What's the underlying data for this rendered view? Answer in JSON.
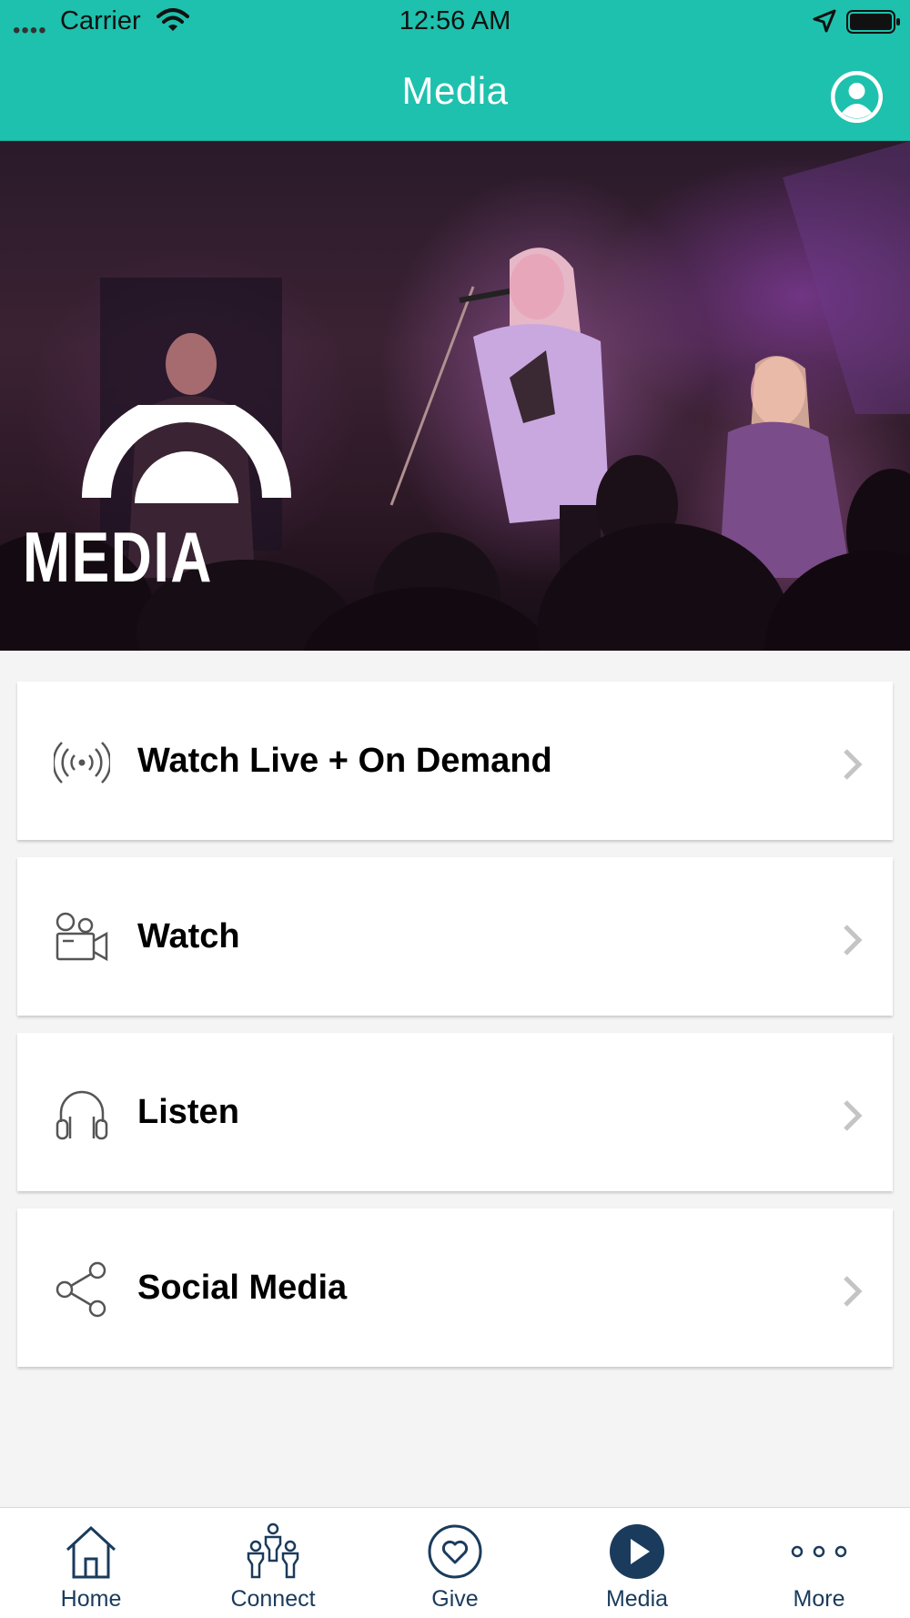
{
  "status_bar": {
    "carrier": "Carrier",
    "time": "12:56 AM"
  },
  "nav": {
    "title": "Media"
  },
  "hero": {
    "logo_text": "MEDIA"
  },
  "menu": [
    {
      "label": "Watch Live + On Demand",
      "icon": "live-broadcast-icon"
    },
    {
      "label": "Watch",
      "icon": "video-camera-icon"
    },
    {
      "label": "Listen",
      "icon": "headphones-icon"
    },
    {
      "label": "Social Media",
      "icon": "share-icon"
    }
  ],
  "tabs": [
    {
      "label": "Home",
      "icon": "home-icon"
    },
    {
      "label": "Connect",
      "icon": "people-icon"
    },
    {
      "label": "Give",
      "icon": "heart-icon"
    },
    {
      "label": "Media",
      "icon": "play-icon",
      "active": true
    },
    {
      "label": "More",
      "icon": "more-icon"
    }
  ],
  "colors": {
    "header": "#1ec1ad",
    "tab_icon": "#1a3b5c",
    "background": "#f4f4f4"
  }
}
